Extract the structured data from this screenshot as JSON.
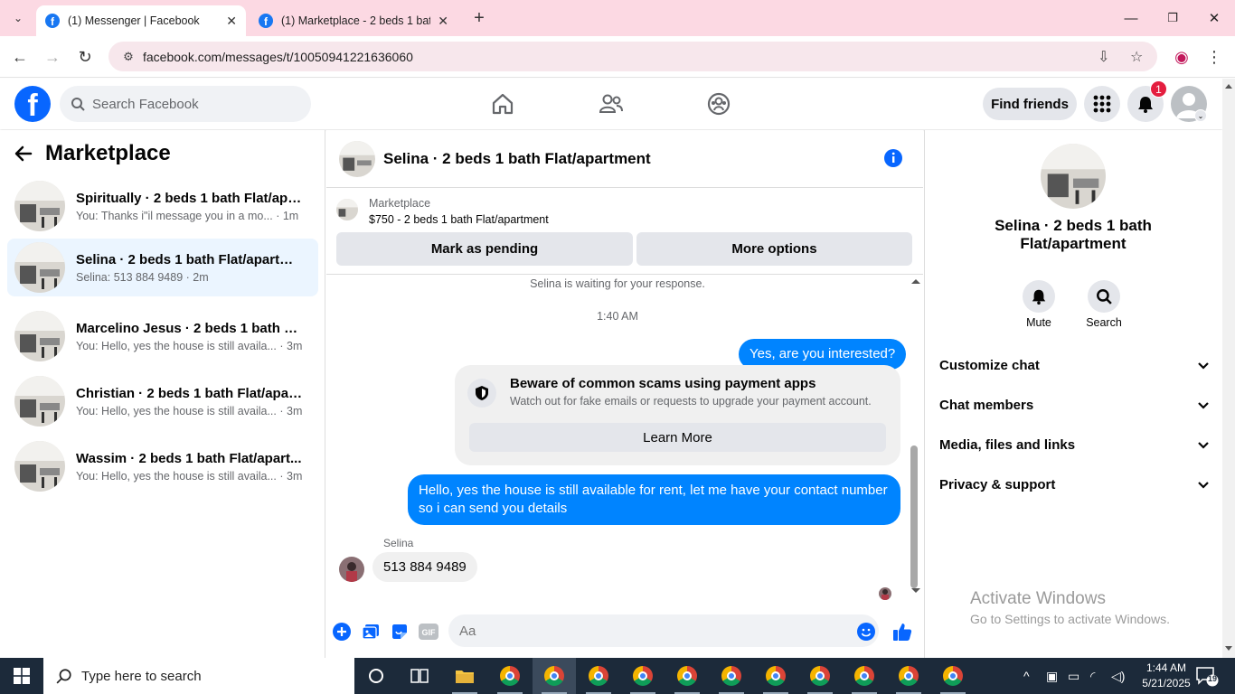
{
  "browser": {
    "tabs": [
      {
        "title": "(1) Messenger | Facebook",
        "active": true
      },
      {
        "title": "(1) Marketplace - 2 beds 1 bath",
        "active": false
      }
    ],
    "url": "facebook.com/messages/t/10050941221636060"
  },
  "header": {
    "search_placeholder": "Search Facebook",
    "find_friends": "Find friends",
    "notification_count": "1"
  },
  "sidebar": {
    "title": "Marketplace",
    "chats": [
      {
        "name": "Spiritually · 2 beds 1 bath Flat/apar...",
        "preview": "You: Thanks i\"il message you in a mo... · 1m",
        "selected": false
      },
      {
        "name": "Selina · 2 beds 1 bath Flat/apartme...",
        "preview": "Selina: 513 884 9489 · 2m",
        "selected": true
      },
      {
        "name": "Marcelino Jesus · 2 beds 1 bath Fla...",
        "preview": "You: Hello, yes the house is still availa... · 3m",
        "selected": false
      },
      {
        "name": "Christian · 2 beds 1 bath Flat/apart...",
        "preview": "You: Hello, yes the house is still availa... · 3m",
        "selected": false
      },
      {
        "name": "Wassim · 2 beds 1 bath Flat/apart...",
        "preview": "You: Hello, yes the house is still availa... · 3m",
        "selected": false
      }
    ]
  },
  "conversation": {
    "title": "Selina · 2 beds 1 bath Flat/apartment",
    "listing_label": "Marketplace",
    "listing_price": "$750 - 2 beds 1 bath Flat/apartment",
    "mark_pending": "Mark as pending",
    "more_options": "More options",
    "waiting": "Selina is waiting for your response.",
    "timestamp": "1:40 AM",
    "msg_out_1": "Yes, are you interested?",
    "scam_title": "Beware of common scams using payment apps",
    "scam_sub": "Watch out for fake emails or requests to upgrade your payment account.",
    "learn_more": "Learn More",
    "msg_out_2": "Hello, yes the house is still available for rent, let me have your contact number so i can send you details",
    "sender": "Selina",
    "msg_in_1": "513 884 9489",
    "input_placeholder": "Aa"
  },
  "details": {
    "name": "Selina · 2 beds 1 bath Flat/apartment",
    "mute": "Mute",
    "search": "Search",
    "sections": [
      "Customize chat",
      "Chat members",
      "Media, files and links",
      "Privacy & support"
    ]
  },
  "watermark": {
    "line1": "Activate Windows",
    "line2": "Go to Settings to activate Windows."
  },
  "taskbar": {
    "search_placeholder": "Type here to search",
    "time": "1:44 AM",
    "date": "5/21/2025",
    "notifications": "19"
  },
  "colors": {
    "fb_blue": "#0866ff",
    "bubble_blue": "#0084ff",
    "tabstrip": "#fcd9e3",
    "badge_red": "#e41e3f"
  }
}
